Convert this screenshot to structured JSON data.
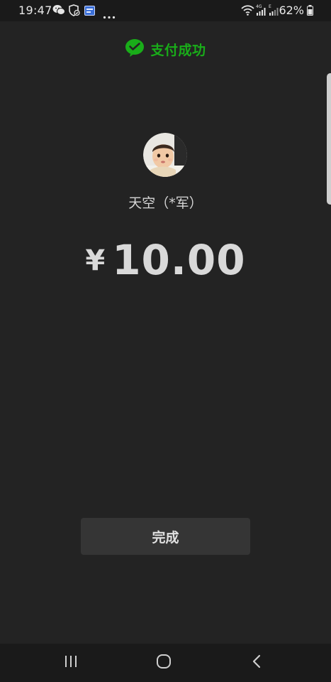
{
  "status_bar": {
    "time": "19:47",
    "battery_percent": "62%",
    "left_icons": [
      "wechat-icon",
      "shield-icon",
      "app-badge-icon",
      "more-dots-icon"
    ],
    "right_icons": [
      "wifi-icon",
      "signal-4g-icon",
      "signal-e-icon",
      "battery-icon"
    ]
  },
  "header": {
    "title": "支付成功",
    "icon": "wechat-pay-icon",
    "accent_color": "#19ad19"
  },
  "payee": {
    "name": "天空（*军）",
    "avatar": "baby-photo-avatar"
  },
  "payment": {
    "currency_symbol": "¥",
    "amount": "10.00"
  },
  "actions": {
    "done_label": "完成"
  },
  "nav_bar": {
    "buttons": [
      "recent-apps-icon",
      "home-icon",
      "back-icon"
    ]
  }
}
